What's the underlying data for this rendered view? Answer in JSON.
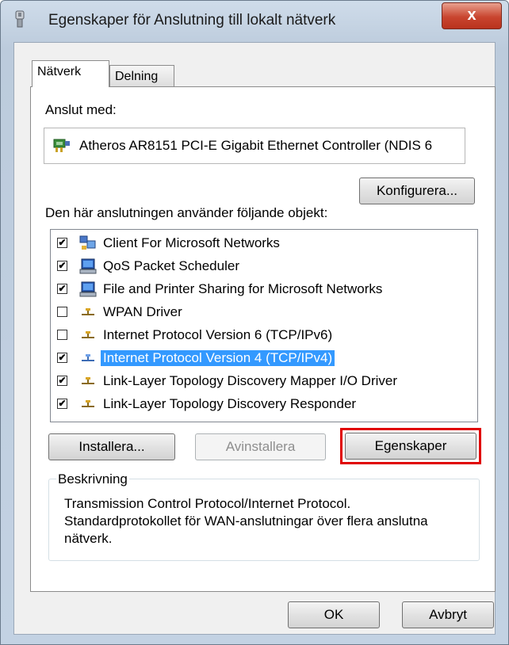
{
  "window": {
    "title": "Egenskaper för Anslutning till lokalt nätverk",
    "close_label": "x"
  },
  "tabs": [
    {
      "label": "Nätverk",
      "active": true
    },
    {
      "label": "Delning",
      "active": false
    }
  ],
  "connect_with": {
    "label": "Anslut med:",
    "adapter": "Atheros AR8151 PCI-E Gigabit Ethernet Controller (NDIS 6",
    "configure_label": "Konfigurera..."
  },
  "items_label": "Den här anslutningen använder följande objekt:",
  "items": [
    {
      "label": "Client For Microsoft Networks",
      "checked": true,
      "icon": "network-client-icon"
    },
    {
      "label": "QoS Packet Scheduler",
      "checked": true,
      "icon": "computer-icon"
    },
    {
      "label": "File and Printer Sharing for Microsoft Networks",
      "checked": true,
      "icon": "computer-icon"
    },
    {
      "label": "WPAN Driver",
      "checked": false,
      "icon": "protocol-icon"
    },
    {
      "label": "Internet Protocol Version 6 (TCP/IPv6)",
      "checked": false,
      "icon": "protocol-icon"
    },
    {
      "label": "Internet Protocol Version 4 (TCP/IPv4)",
      "checked": true,
      "icon": "protocol-icon",
      "selected": true
    },
    {
      "label": "Link-Layer Topology Discovery Mapper I/O Driver",
      "checked": true,
      "icon": "protocol-icon"
    },
    {
      "label": "Link-Layer Topology Discovery Responder",
      "checked": true,
      "icon": "protocol-icon"
    }
  ],
  "actions": {
    "install_label": "Installera...",
    "uninstall_label": "Avinstallera",
    "properties_label": "Egenskaper"
  },
  "description": {
    "title": "Beskrivning",
    "text": "Transmission Control Protocol/Internet Protocol. Standardprotokollet för WAN-anslutningar över flera anslutna nätverk."
  },
  "footer": {
    "ok_label": "OK",
    "cancel_label": "Avbryt"
  },
  "colors": {
    "selection": "#3399ff",
    "highlight_border": "#e00000",
    "close_button": "#c9452f"
  }
}
